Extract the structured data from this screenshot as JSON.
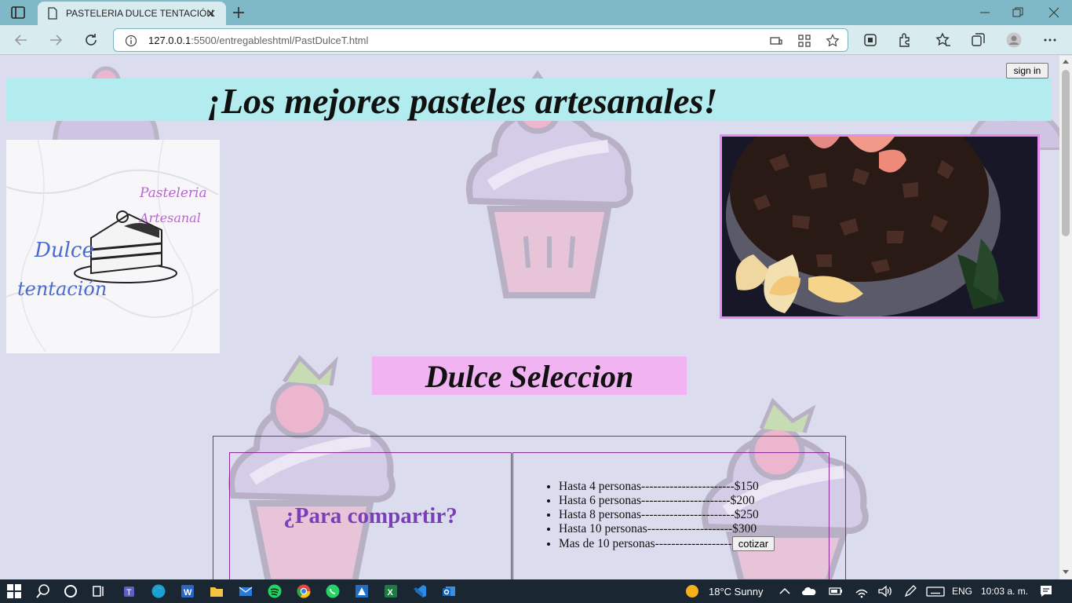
{
  "browser": {
    "tab_title": "PASTELERIA DULCE TENTACIÓN",
    "url_host": "127.0.0.1",
    "url_rest": ":5500/entregableshtml/PastDulceT.html"
  },
  "page": {
    "signin_label": "sign in",
    "hero_title": "¡Los mejores pasteles artesanales!",
    "logo": {
      "line1": "Pasteleria",
      "line2": "Artesanal",
      "line3": "Dulce",
      "line4": "tentación"
    },
    "section_title": "Dulce Seleccion",
    "share_question": "¿Para compartir?",
    "prices": [
      "Hasta 4 personas-----------------------$150",
      "Hasta 6 personas----------------------$200",
      "Hasta 8 personas-----------------------$250",
      "Hasta 10 personas---------------------$300"
    ],
    "last_option": "Mas de 10 personas-------------------",
    "cotizar_label": "cotizar"
  },
  "taskbar": {
    "weather": "18°C  Sunny",
    "language": "ENG",
    "time": "10:03 a. m."
  },
  "colors": {
    "page_bg": "#dcdcef",
    "hero_bg": "#b2ecee",
    "section_bg": "#f2b3f3",
    "table_border": "#8a2a9a",
    "question_text": "#7a3fb8"
  }
}
